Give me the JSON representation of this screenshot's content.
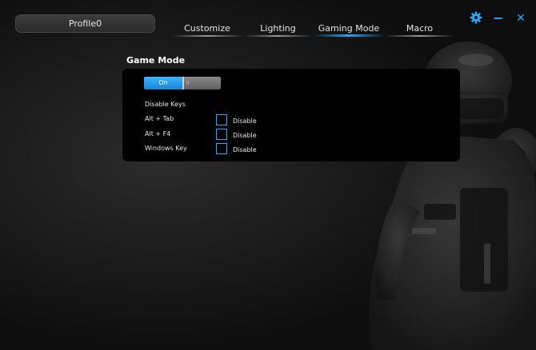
{
  "profile": {
    "name": "Profile0"
  },
  "tabs": [
    {
      "label": "Customize",
      "active": false
    },
    {
      "label": "Lighting",
      "active": false
    },
    {
      "label": "Gaming Mode",
      "active": true
    },
    {
      "label": "Macro",
      "active": false
    }
  ],
  "window": {
    "settings_icon": "gear-icon",
    "minimize_glyph": "−",
    "close_glyph": "✕"
  },
  "game_mode": {
    "title": "Game Mode",
    "toggle": {
      "on_label": "On",
      "grip": "||",
      "state": "on"
    },
    "disable_keys_label": "Disable Keys",
    "keys": [
      {
        "label": "Alt + Tab",
        "checkbox_label": "Disable",
        "checked": false
      },
      {
        "label": "Alt + F4",
        "checkbox_label": "Disable",
        "checked": false
      },
      {
        "label": "Windows Key",
        "checkbox_label": "Disable",
        "checked": false
      }
    ]
  },
  "colors": {
    "accent": "#22a8ff",
    "background": "#1e1e1e",
    "panel": "#000000"
  }
}
